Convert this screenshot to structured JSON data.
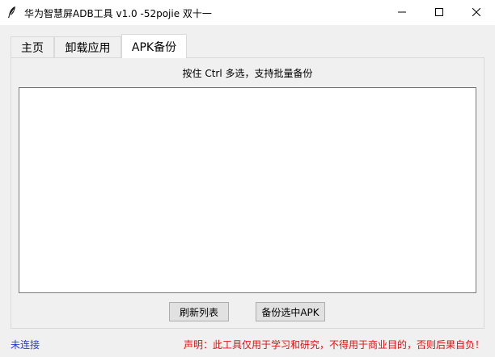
{
  "window": {
    "title": "华为智慧屏ADB工具 v1.0 -52pojie 双十一",
    "icon": "feather-icon",
    "controls": [
      "minimize-icon",
      "maximize-icon",
      "close-icon"
    ]
  },
  "tabs": [
    {
      "label": "主页",
      "active": false
    },
    {
      "label": "卸载应用",
      "active": false
    },
    {
      "label": "APK备份",
      "active": true
    }
  ],
  "backup": {
    "hint": "按住 Ctrl 多选，支持批量备份",
    "list_items": [],
    "refresh_label": "刷新列表",
    "backup_label": "备份选中APK"
  },
  "status": {
    "connection": "未连接",
    "disclaimer": "声明：此工具仅用于学习和研究，不得用于商业目的，否则后果自负！",
    "connection_color": "#1f3fd6",
    "disclaimer_color": "#e01010"
  }
}
